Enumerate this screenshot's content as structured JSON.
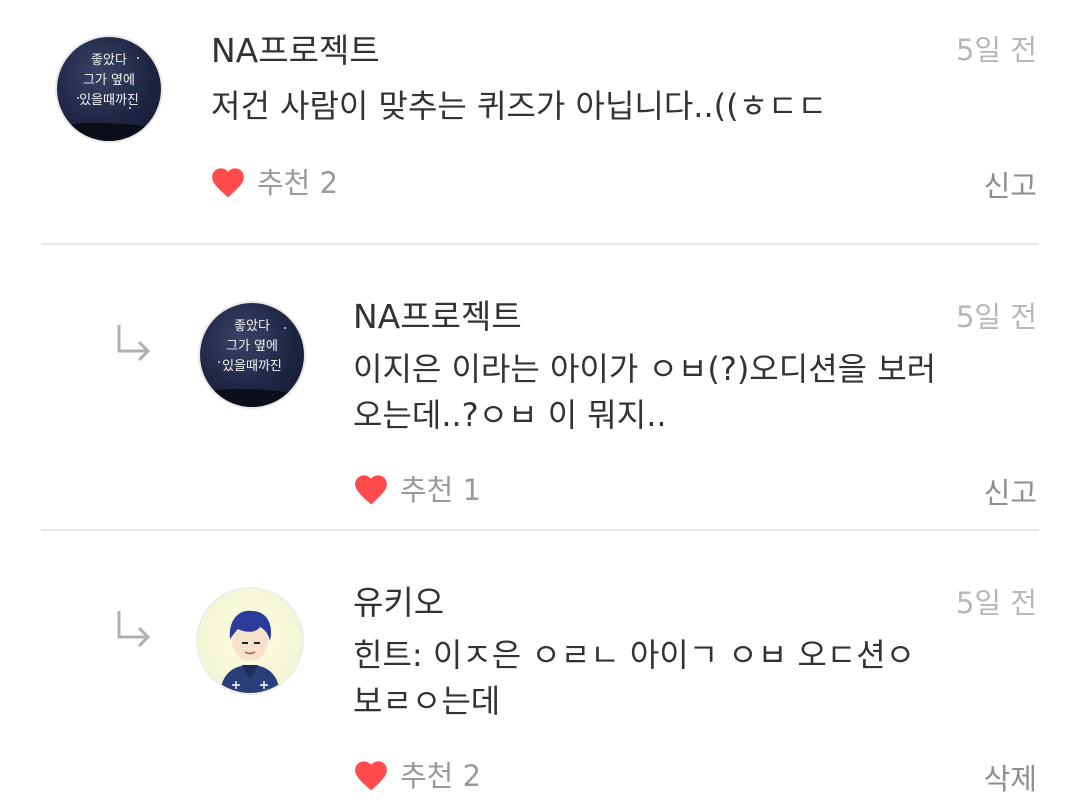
{
  "colors": {
    "heart": "#ff4b4b",
    "time": "#b7b7b7",
    "text": "#333333",
    "muted": "#9a9a9a",
    "divider": "#e6e6e6"
  },
  "avatar_caption": [
    "좋았다",
    "그가 옆에",
    "있을때까진"
  ],
  "comments": [
    {
      "author": "NA프로젝트",
      "time": "5일 전",
      "lines": [
        "저건 사람이 맞추는 퀴즈가 아닙니다..((ㅎㄷㄷ"
      ],
      "like_label": "추천 2",
      "action": "신고"
    },
    {
      "author": "NA프로젝트",
      "time": "5일 전",
      "lines": [
        "이지은 이라는 아이가 ㅇㅂ(?)오디션을 보러",
        "오는데..?ㅇㅂ 이 뭐지.."
      ],
      "like_label": "추천 1",
      "action": "신고"
    },
    {
      "author": "유키오",
      "time": "5일 전",
      "lines": [
        "힌트: 이ㅈ은 ㅇㄹㄴ 아이ㄱ ㅇㅂ 오ㄷ션ㅇ",
        "보ㄹㅇ는데"
      ],
      "like_label": "추천 2",
      "action": "삭제"
    }
  ]
}
